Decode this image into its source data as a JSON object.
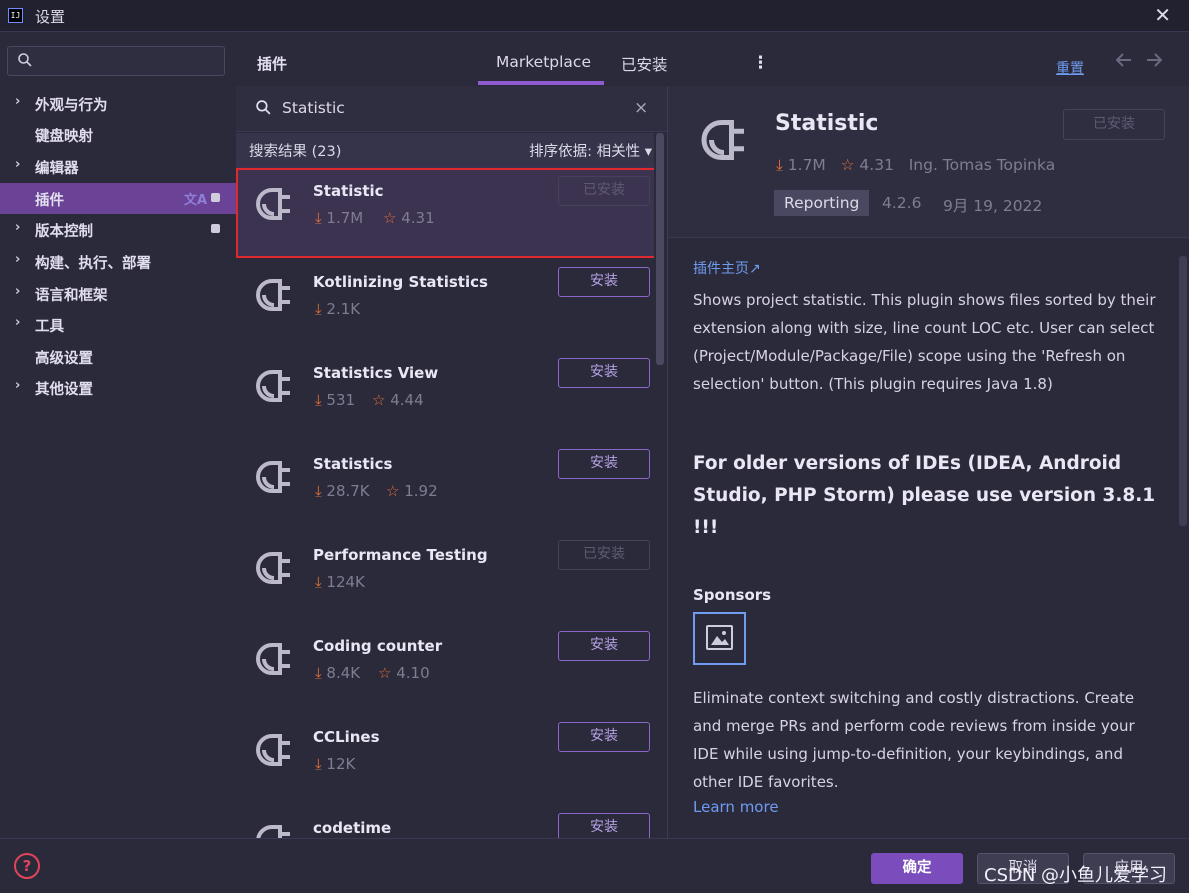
{
  "window": {
    "app_icon": "IJ",
    "title": "设置",
    "close": "✕"
  },
  "sidebar": {
    "search_icon": "Q",
    "items": [
      {
        "label": "外观与行为",
        "arrow": "›",
        "expandable": true
      },
      {
        "label": "键盘映射",
        "arrow": "",
        "expandable": false
      },
      {
        "label": "编辑器",
        "arrow": "›",
        "expandable": true
      },
      {
        "label": "插件",
        "arrow": "",
        "expandable": false,
        "active": true,
        "translate_icon": "文A"
      },
      {
        "label": "版本控制",
        "arrow": "›",
        "expandable": true
      },
      {
        "label": "构建、执行、部署",
        "arrow": "›",
        "expandable": true
      },
      {
        "label": "语言和框架",
        "arrow": "›",
        "expandable": true
      },
      {
        "label": "工具",
        "arrow": "›",
        "expandable": true
      },
      {
        "label": "高级设置",
        "arrow": "",
        "expandable": false
      },
      {
        "label": "其他设置",
        "arrow": "›",
        "expandable": true
      }
    ]
  },
  "plugins": {
    "title": "插件",
    "tabs": {
      "marketplace": "Marketplace",
      "installed": "已安装"
    },
    "kebab": "⋮",
    "reset": "重置",
    "search": {
      "icon": "Q",
      "value": "Statistic",
      "clear": "×"
    },
    "results_count": "搜索结果 (23)",
    "sort": "排序依据: 相关性 ▾",
    "list": [
      {
        "name": "Statistic",
        "downloads": "1.7M",
        "rating": "4.31",
        "button": "已安装",
        "installed": true
      },
      {
        "name": "Kotlinizing Statistics",
        "downloads": "2.1K",
        "rating": "",
        "button": "安装",
        "installed": false
      },
      {
        "name": "Statistics View",
        "downloads": "531",
        "rating": "4.44",
        "button": "安装",
        "installed": false
      },
      {
        "name": "Statistics",
        "downloads": "28.7K",
        "rating": "1.92",
        "button": "安装",
        "installed": false
      },
      {
        "name": "Performance Testing",
        "downloads": "124K",
        "rating": "",
        "button": "已安装",
        "installed": true
      },
      {
        "name": "Coding counter",
        "downloads": "8.4K",
        "rating": "4.10",
        "button": "安装",
        "installed": false
      },
      {
        "name": "CCLines",
        "downloads": "12K",
        "rating": "",
        "button": "安装",
        "installed": false
      },
      {
        "name": "codetime",
        "downloads": "",
        "rating": "",
        "button": "安装",
        "installed": false
      }
    ]
  },
  "detail": {
    "name": "Statistic",
    "installed_label": "已安装",
    "downloads": "1.7M",
    "rating": "4.31",
    "vendor": "Ing. Tomas Topinka",
    "tag": "Reporting",
    "version": "4.2.6",
    "date": "9月 19, 2022",
    "homepage": "插件主页↗",
    "description": "Shows project statistic. This plugin shows files sorted by their extension along with size, line count LOC etc. User can select (Project/Module/Package/File) scope using the 'Refresh on selection' button. (This plugin requires Java 1.8)",
    "older": "For older versions of IDEs (IDEA, Android Studio, PHP Storm) please use version 3.8.1 !!!",
    "sponsors_title": "Sponsors",
    "sponsor_text": "Eliminate context switching and costly distractions. Create and merge PRs and perform code reviews from inside your IDE while using jump-to-definition, your keybindings, and other IDE favorites.",
    "learn_more": "Learn more"
  },
  "footer": {
    "help": "?",
    "ok": "确定",
    "cancel": "取消",
    "apply": "应用",
    "watermark": "CSDN @小鱼儿爱学习"
  },
  "colors": {
    "accent": "#7a4cbc",
    "download_star": "#e36f38",
    "link": "#6f9cf0",
    "selection_outline": "#e0282f"
  }
}
